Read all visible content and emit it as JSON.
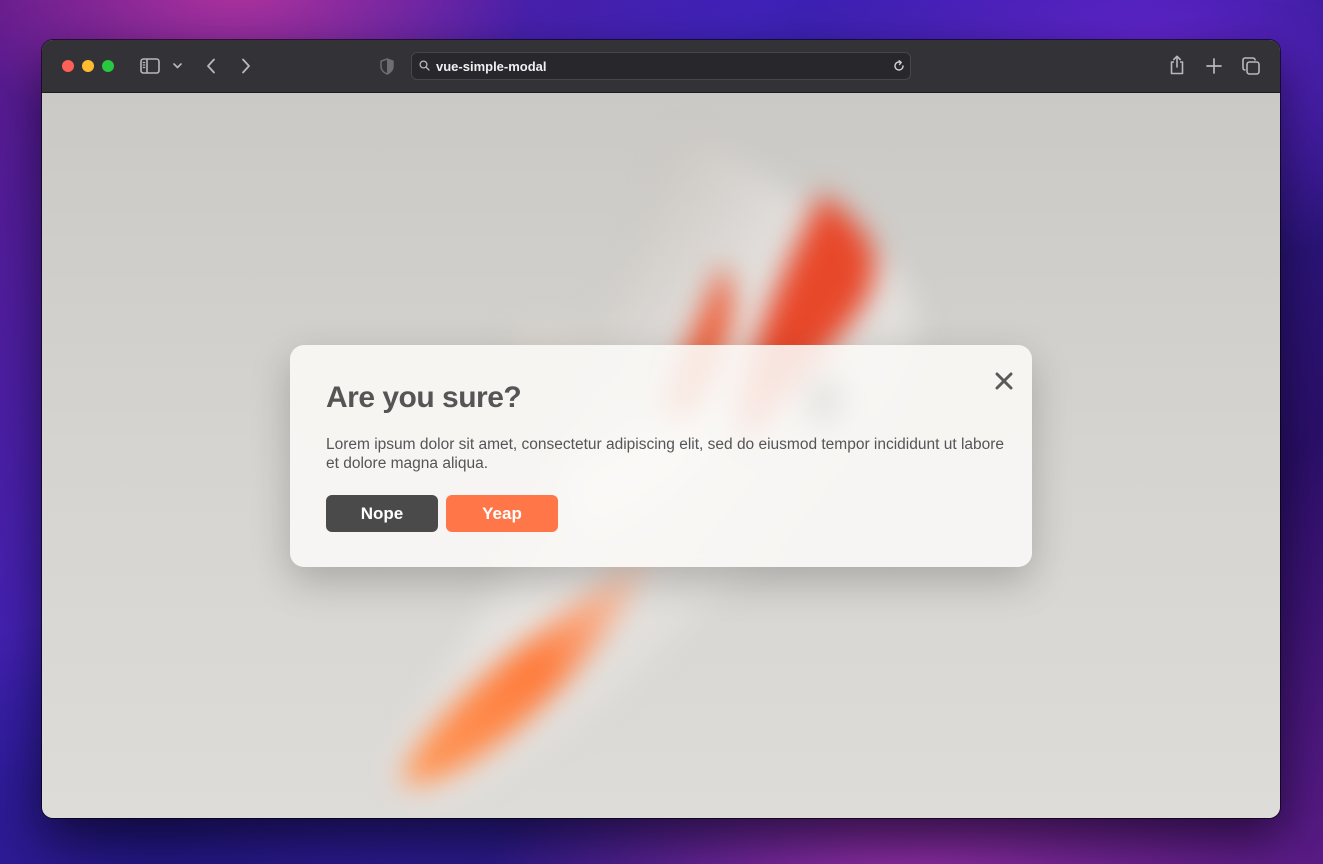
{
  "browser": {
    "address_text": "vue-simple-modal"
  },
  "modal": {
    "title": "Are you sure?",
    "body": "Lorem ipsum dolor sit amet, consectetur adipiscing elit, sed do eiusmod tempor incididunt ut labore et dolore magna aliqua.",
    "cancel_label": "Nope",
    "confirm_label": "Yeap",
    "close_icon": "close-icon"
  },
  "colors": {
    "confirm_button": "#ff7648",
    "cancel_button": "#4a4a4a",
    "text": "#555555",
    "toolbar": "#333236"
  },
  "icons": {
    "toolbar": [
      "sidebar-icon",
      "chevron-down-icon",
      "back-icon",
      "forward-icon",
      "shield-icon",
      "search-icon",
      "reload-icon",
      "share-icon",
      "new-tab-icon",
      "tab-overview-icon"
    ]
  }
}
